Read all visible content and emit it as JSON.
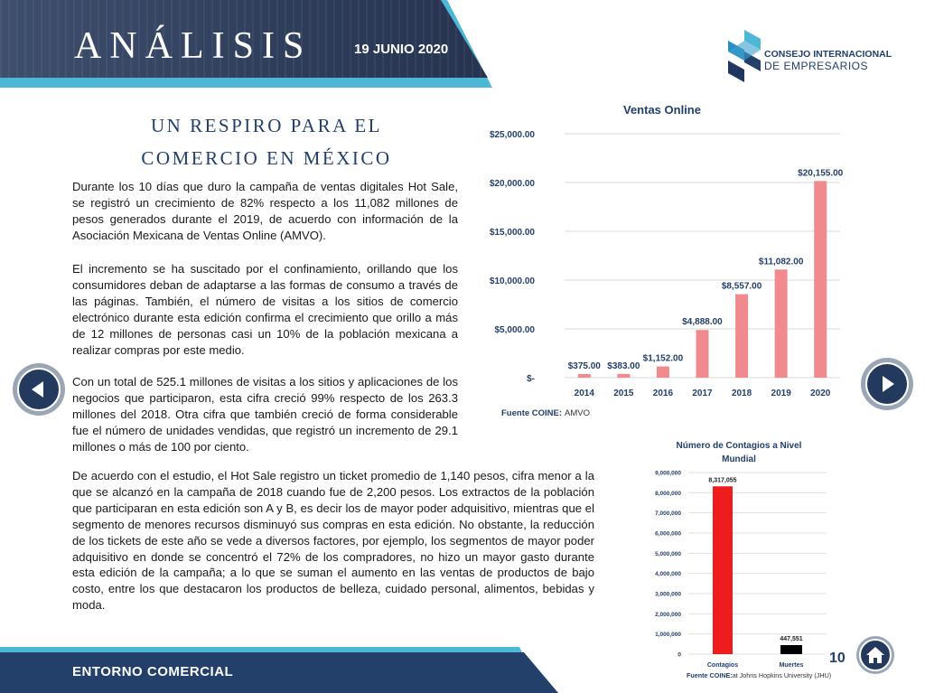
{
  "header": {
    "title": "ANÁLISIS",
    "date": "19 JUNIO 2020"
  },
  "logo": {
    "line1": "CONSEJO INTERNACIONAL",
    "line2": "DE EMPRESARIOS"
  },
  "article": {
    "title_line1": "UN RESPIRO PARA EL",
    "title_line2": "COMERCIO EN MÉXICO",
    "paragraphs": [
      "Durante los 10 días que duro la campaña de ventas digitales Hot Sale, se registró un crecimiento de 82% respecto a los 11,082 millones de pesos generados durante el 2019, de acuerdo con información de la Asociación Mexicana de Ventas Online (AMVO).",
      "El incremento se ha suscitado por el confinamiento, orillando que los consumidores deban de adaptarse a las formas de consumo a través de las páginas. También, el número de visitas a los sitios de comercio electrónico durante esta edición confirma el crecimiento que orillo a más de 12 millones de personas casi un 10% de la población mexicana a realizar compras por este medio.",
      "Con un total de 525.1 millones de visitas a los sitios y aplicaciones de los negocios que participaron, esta cifra creció 99% respecto de los 263.3 millones del 2018. Otra cifra que también creció de forma considerable fue el número de unidades vendidas, que registró un incremento de 29.1 millones o más de 100 por ciento.",
      "De acuerdo con el estudio, el Hot Sale registro un ticket promedio de 1,140 pesos, cifra menor a la que se alcanzó en la campaña de 2018 cuando fue de 2,200 pesos. Los extractos de la población que participaran en esta edición son A y B, es decir los de mayor poder adquisitivo, mientras que el segmento de menores recursos disminuyó sus compras en esta edición. No obstante, la reducción de los tickets de este año se vede a diversos factores, por ejemplo, los segmentos de mayor poder adquisitivo en donde se concentró el 72% de los compradores, no hizo un mayor gasto durante esta edición de la campaña; a lo que se suman el aumento en las ventas de productos de bajo costo, entre los que destacaron los productos de belleza, cuidado personal, alimentos, bebidas y moda."
    ]
  },
  "chart_data": [
    {
      "type": "bar",
      "title": "Ventas Online",
      "categories": [
        "2014",
        "2015",
        "2016",
        "2017",
        "2018",
        "2019",
        "2020"
      ],
      "values": [
        375,
        383,
        1152,
        4888,
        8557,
        11082,
        20155
      ],
      "value_labels": [
        "$375.00",
        "$383.00",
        "$1,152.00",
        "$4,888.00",
        "$8,557.00",
        "$11,082.00",
        "$20,155.00"
      ],
      "yticks": [
        "$-",
        "$5,000.00",
        "$10,000.00",
        "$15,000.00",
        "$20,000.00",
        "$25,000.00"
      ],
      "ylim": [
        0,
        25000
      ],
      "grid": true,
      "bar_color": "#f08a8e",
      "source_label": "Fuente COINE:",
      "source_text": "AMVO"
    },
    {
      "type": "bar",
      "title_line1": "Número de Contagios a Nivel",
      "title_line2": "Mundial",
      "categories": [
        "Contagios",
        "Muertes"
      ],
      "values": [
        8317055,
        447551
      ],
      "value_labels": [
        "8,317,055",
        "447,551"
      ],
      "bar_colors": [
        "#ee1c1c",
        "#000000"
      ],
      "yticks": [
        "0",
        "1,000,000",
        "2,000,000",
        "3,000,000",
        "4,000,000",
        "5,000,000",
        "6,000,000",
        "7,000,000",
        "8,000,000",
        "9,000,000"
      ],
      "ylim": [
        0,
        9000000
      ],
      "grid": true,
      "source_label": "Fuente COINE:",
      "source_text": "at Johns Hopkins University (JHU)"
    }
  ],
  "footer": {
    "label": "ENTORNO COMERCIAL",
    "page_number": "10"
  },
  "icons": {
    "prev": "arrow-left-icon",
    "next": "arrow-right-icon",
    "home": "home-icon"
  },
  "colors": {
    "navy": "#23406b",
    "cyan": "#4cb8d6"
  }
}
